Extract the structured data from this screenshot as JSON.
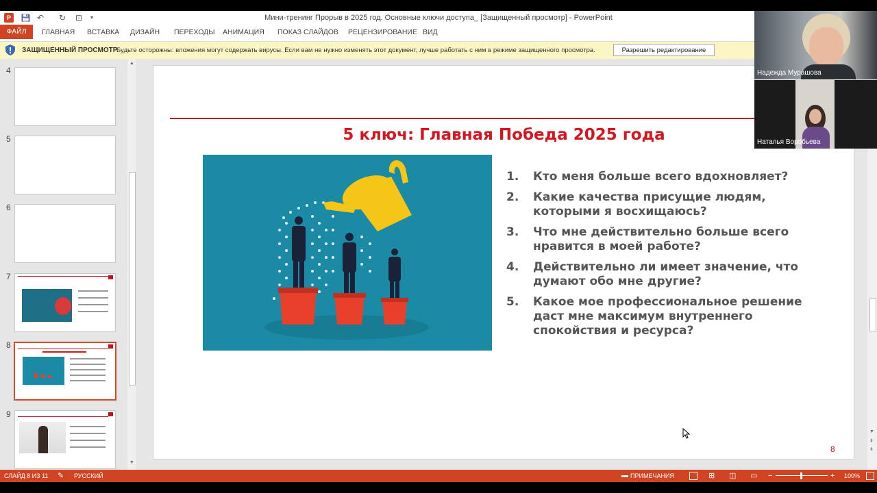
{
  "window": {
    "title": "Мини-тренинг Прорыв в 2025 год. Основные ключи доступа_ [Защищенный просмотр] - PowerPoint",
    "app_icon": "powerpoint-icon",
    "quick_access": [
      "save-icon",
      "undo-icon",
      "redo-icon",
      "slideshow-from-start-icon"
    ]
  },
  "ribbon": {
    "tabs": [
      "ФАЙЛ",
      "ГЛАВНАЯ",
      "ВСТАВКА",
      "ДИЗАЙН",
      "ПЕРЕХОДЫ",
      "АНИМАЦИЯ",
      "ПОКАЗ СЛАЙДОВ",
      "РЕЦЕНЗИРОВАНИЕ",
      "ВИД"
    ],
    "active_tab": "ФАЙЛ"
  },
  "protected_view": {
    "title": "ЗАЩИЩЕННЫЙ ПРОСМОТР",
    "message": "Будьте осторожны: вложения могут содержать вирусы. Если вам не нужно изменять этот документ, лучше работать с ним в режиме защищенного просмотра.",
    "button": "Разрешить редактирование"
  },
  "thumbnails": {
    "items": [
      {
        "num": "4"
      },
      {
        "num": "5"
      },
      {
        "num": "6"
      },
      {
        "num": "7"
      },
      {
        "num": "8"
      },
      {
        "num": "9"
      }
    ],
    "selected": "8"
  },
  "slide": {
    "title": "5 ключ: Главная Победа 2025 года",
    "questions": [
      {
        "n": "1.",
        "text": "Кто меня больше всего вдохновляет?"
      },
      {
        "n": "2.",
        "text": "Какие качества присущие людям, которыми я восхищаюсь?"
      },
      {
        "n": "3.",
        "text": "Что мне действительно больше всего нравится в моей работе?"
      },
      {
        "n": "4.",
        "text": "Действительно ли имеет значение, что думают обо мне другие?"
      },
      {
        "n": "5.",
        "text": "Какое мое профессиональное решение даст мне максимум внутреннего спокойствия и ресурса?"
      }
    ],
    "page_number": "8",
    "accent_color": "#d4171f",
    "image_bg_color": "#1b8ba5"
  },
  "status_bar": {
    "slide_info": "СЛАЙД 8 ИЗ 11",
    "language": "РУССКИЙ",
    "notes": "ПРИМЕЧАНИЯ",
    "zoom": "100%"
  },
  "participants": [
    {
      "name": "Надежда Мурашова"
    },
    {
      "name": "Наталья Воробьева"
    }
  ]
}
